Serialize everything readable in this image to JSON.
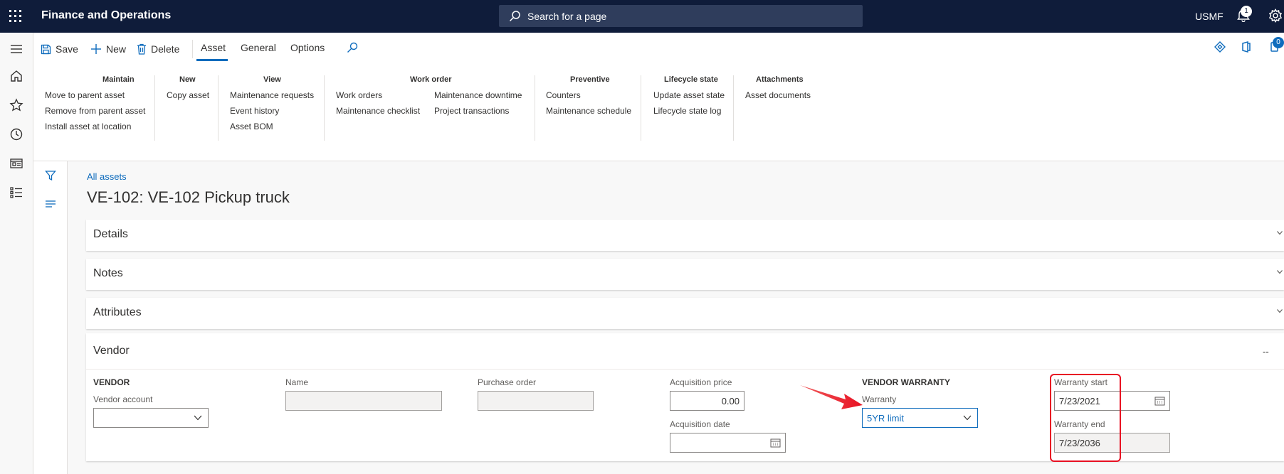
{
  "app": {
    "title": "Finance and Operations",
    "search_placeholder": "Search for a page",
    "company": "USMF",
    "notification_count": "1"
  },
  "toolbar": {
    "save": "Save",
    "new": "New",
    "delete": "Delete",
    "tabs": [
      "Asset",
      "General",
      "Options"
    ],
    "right_badge": "0"
  },
  "groups": {
    "maintain": {
      "title": "Maintain",
      "items": [
        "Move to parent asset",
        "Remove from parent asset",
        "Install asset at location"
      ]
    },
    "new": {
      "title": "New",
      "items": [
        "Copy asset"
      ]
    },
    "view": {
      "title": "View",
      "items": [
        "Maintenance requests",
        "Event history",
        "Asset BOM"
      ]
    },
    "work_order": {
      "title": "Work order",
      "items": [
        "Work orders",
        "Maintenance checklist",
        "Maintenance downtime",
        "Project transactions"
      ]
    },
    "preventive": {
      "title": "Preventive",
      "items": [
        "Counters",
        "Maintenance schedule"
      ]
    },
    "lifecycle": {
      "title": "Lifecycle state",
      "items": [
        "Update asset state",
        "Lifecycle state log"
      ]
    },
    "attachments": {
      "title": "Attachments",
      "items": [
        "Asset documents"
      ]
    }
  },
  "page": {
    "breadcrumb": "All assets",
    "title": "VE-102: VE-102 Pickup truck"
  },
  "fasttabs": [
    "Details",
    "Notes",
    "Attributes",
    "Vendor"
  ],
  "vendor": {
    "collapse_indicator": "--",
    "vendor_heading": "VENDOR",
    "vendor_account_label": "Vendor account",
    "vendor_account_value": "",
    "name_label": "Name",
    "name_value": "",
    "purchase_order_label": "Purchase order",
    "purchase_order_value": "",
    "acquisition_price_label": "Acquisition price",
    "acquisition_price_value": "0.00",
    "acquisition_date_label": "Acquisition date",
    "acquisition_date_value": "",
    "warranty_heading": "VENDOR WARRANTY",
    "warranty_label": "Warranty",
    "warranty_value": "5YR limit",
    "warranty_start_label": "Warranty start",
    "warranty_start_value": "7/23/2021",
    "warranty_end_label": "Warranty end",
    "warranty_end_value": "7/23/2036"
  },
  "colors": {
    "topbar": "#0f1c3a",
    "accent": "#0f6cbd",
    "highlight": "#e81123"
  }
}
